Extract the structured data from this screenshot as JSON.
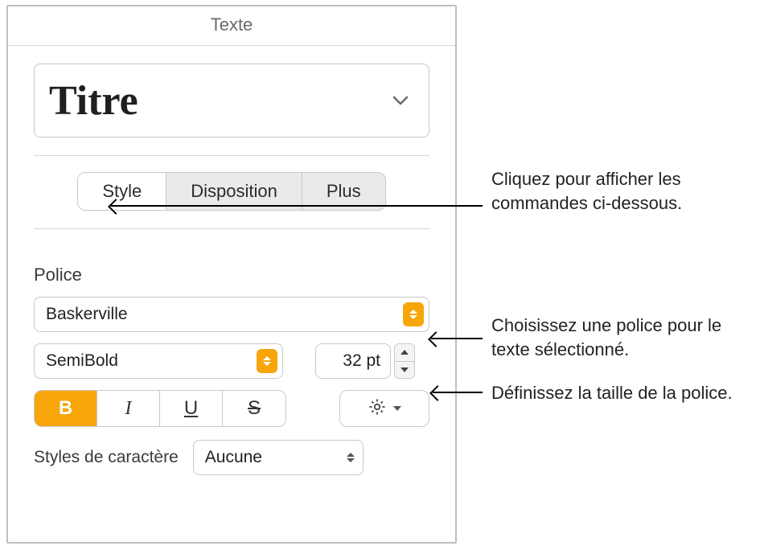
{
  "panel": {
    "title": "Texte",
    "paragraph_style": "Titre",
    "tabs": {
      "style": "Style",
      "layout": "Disposition",
      "more": "Plus"
    },
    "font": {
      "section_label": "Police",
      "family": "Baskerville",
      "weight": "SemiBold",
      "size": "32 pt",
      "bold": "B",
      "italic": "I",
      "underline": "U",
      "strike": "S"
    },
    "char_styles": {
      "label": "Styles de caractère",
      "value": "Aucune"
    }
  },
  "callouts": {
    "tabs": "Cliquez pour afficher les commandes ci-dessous.",
    "font": "Choisissez une police pour le texte sélectionné.",
    "size": "Définissez la taille de la police."
  }
}
